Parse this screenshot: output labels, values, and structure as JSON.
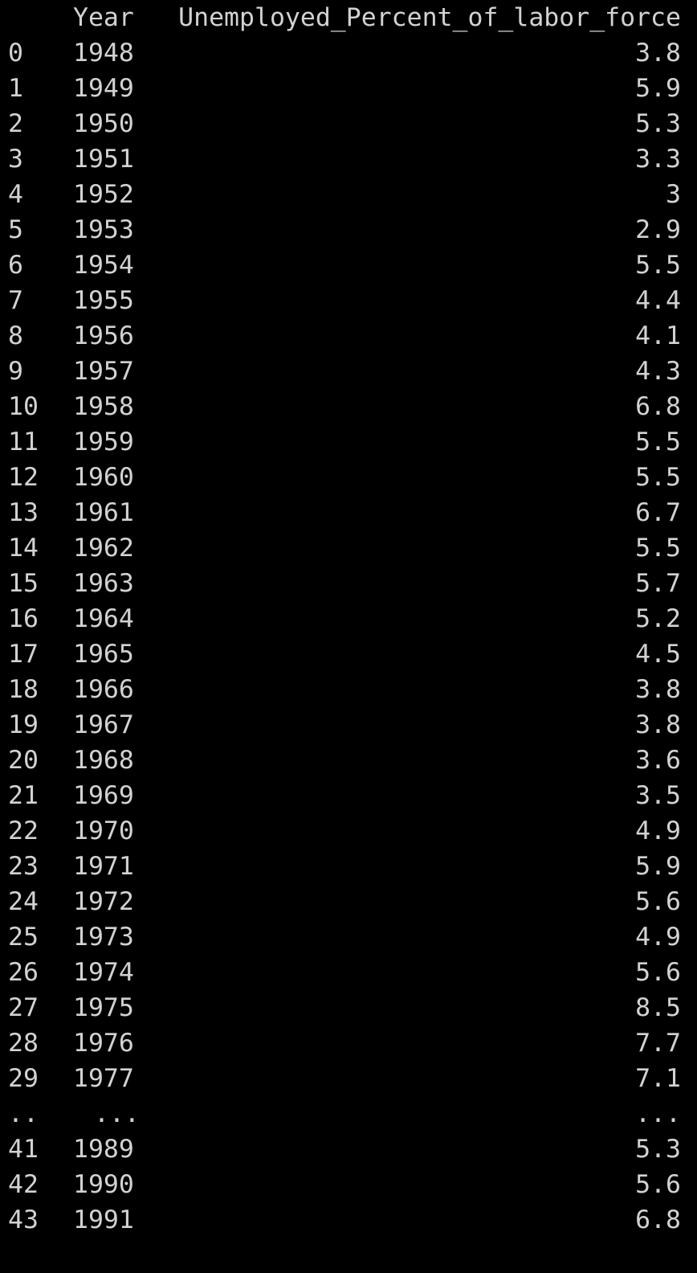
{
  "table": {
    "columns": [
      "Year",
      "Unemployed_Percent_of_labor_force"
    ],
    "rows_top": [
      {
        "index": "0",
        "year": "1948",
        "value": "3.8"
      },
      {
        "index": "1",
        "year": "1949",
        "value": "5.9"
      },
      {
        "index": "2",
        "year": "1950",
        "value": "5.3"
      },
      {
        "index": "3",
        "year": "1951",
        "value": "3.3"
      },
      {
        "index": "4",
        "year": "1952",
        "value": "3"
      },
      {
        "index": "5",
        "year": "1953",
        "value": "2.9"
      },
      {
        "index": "6",
        "year": "1954",
        "value": "5.5"
      },
      {
        "index": "7",
        "year": "1955",
        "value": "4.4"
      },
      {
        "index": "8",
        "year": "1956",
        "value": "4.1"
      },
      {
        "index": "9",
        "year": "1957",
        "value": "4.3"
      },
      {
        "index": "10",
        "year": "1958",
        "value": "6.8"
      },
      {
        "index": "11",
        "year": "1959",
        "value": "5.5"
      },
      {
        "index": "12",
        "year": "1960",
        "value": "5.5"
      },
      {
        "index": "13",
        "year": "1961",
        "value": "6.7"
      },
      {
        "index": "14",
        "year": "1962",
        "value": "5.5"
      },
      {
        "index": "15",
        "year": "1963",
        "value": "5.7"
      },
      {
        "index": "16",
        "year": "1964",
        "value": "5.2"
      },
      {
        "index": "17",
        "year": "1965",
        "value": "4.5"
      },
      {
        "index": "18",
        "year": "1966",
        "value": "3.8"
      },
      {
        "index": "19",
        "year": "1967",
        "value": "3.8"
      },
      {
        "index": "20",
        "year": "1968",
        "value": "3.6"
      },
      {
        "index": "21",
        "year": "1969",
        "value": "3.5"
      },
      {
        "index": "22",
        "year": "1970",
        "value": "4.9"
      },
      {
        "index": "23",
        "year": "1971",
        "value": "5.9"
      },
      {
        "index": "24",
        "year": "1972",
        "value": "5.6"
      },
      {
        "index": "25",
        "year": "1973",
        "value": "4.9"
      },
      {
        "index": "26",
        "year": "1974",
        "value": "5.6"
      },
      {
        "index": "27",
        "year": "1975",
        "value": "8.5"
      },
      {
        "index": "28",
        "year": "1976",
        "value": "7.7"
      },
      {
        "index": "29",
        "year": "1977",
        "value": "7.1"
      }
    ],
    "ellipsis": {
      "index": "..",
      "year": "...",
      "value": "..."
    },
    "rows_bottom": [
      {
        "index": "41",
        "year": "1989",
        "value": "5.3"
      },
      {
        "index": "42",
        "year": "1990",
        "value": "5.6"
      },
      {
        "index": "43",
        "year": "1991",
        "value": "6.8"
      }
    ]
  },
  "colors": {
    "background": "#000000",
    "text": "#d2d2d2"
  }
}
